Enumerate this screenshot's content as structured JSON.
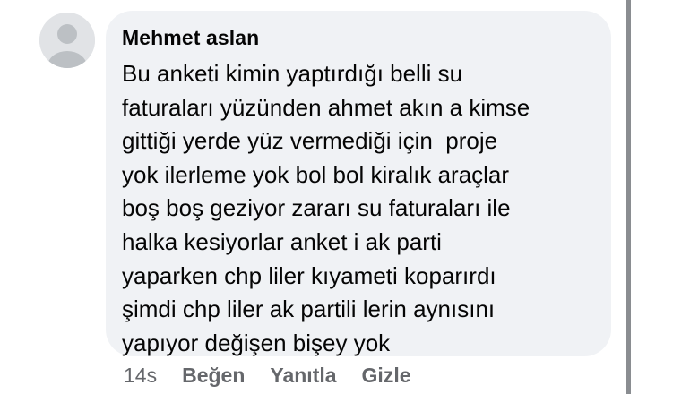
{
  "comment": {
    "author": "Mehmet aslan",
    "lines": [
      "Bu anketi kimin yaptırdığı belli su",
      "faturaları yüzünden ahmet akın a kimse",
      "gittiği yerde yüz vermediği için  proje",
      "yok ilerleme yok bol bol kiralık araçlar",
      "boş boş geziyor zararı su faturaları ile",
      "halka kesiyorlar anket i ak parti",
      "yaparken chp liler kıyameti koparırdı",
      "şimdi chp liler ak partili lerin aynısını",
      "yapıyor değişen bişey yok"
    ],
    "timestamp": "14s",
    "actions": {
      "like": "Beğen",
      "reply": "Yanıtla",
      "hide": "Gizle"
    }
  },
  "avatar": {
    "icon": "default-user-icon"
  },
  "colors": {
    "bubble_bg": "#f0f2f5",
    "text": "#050505",
    "secondary_text": "#65676b",
    "avatar_bg": "#e1e3e6",
    "avatar_fg": "#bcc0c4"
  }
}
